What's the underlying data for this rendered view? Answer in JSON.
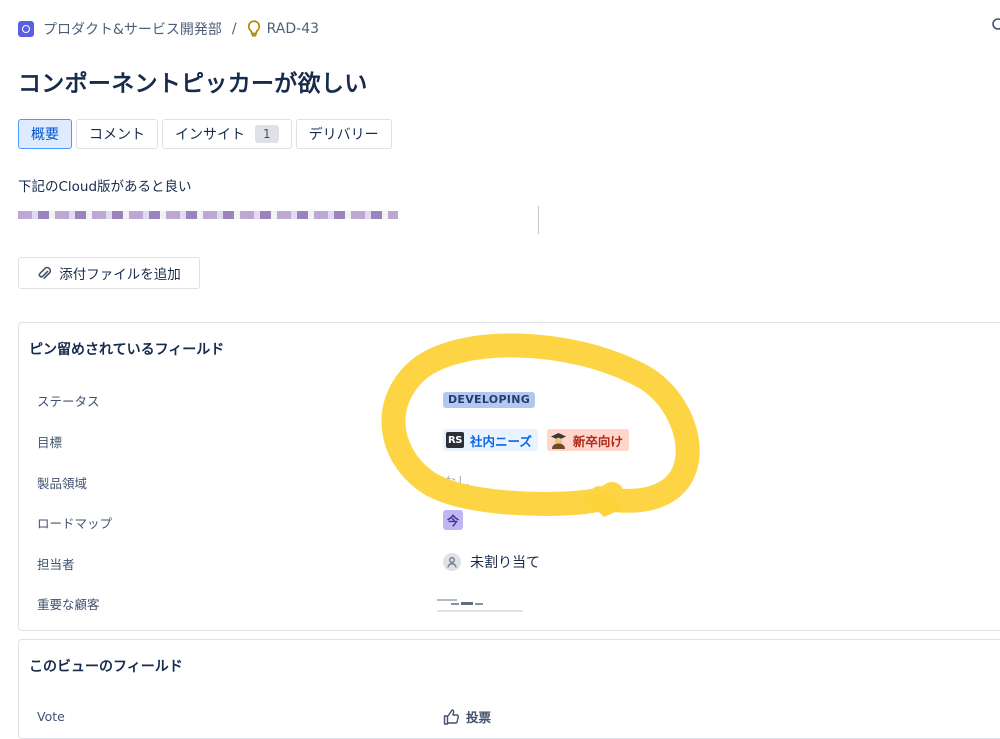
{
  "breadcrumb": {
    "project": "プロダクト&サービス開発部",
    "separator": "/",
    "issue_key": "RAD-43"
  },
  "title": "コンポーネントピッカーが欲しい",
  "tabs": [
    {
      "label": "概要",
      "active": true
    },
    {
      "label": "コメント"
    },
    {
      "label": "インサイト",
      "count": "1"
    },
    {
      "label": "デリバリー"
    }
  ],
  "description": "下記のCloud版があると良い",
  "attach_button": "添付ファイルを追加",
  "pinned": {
    "title": "ピン留めされているフィールド",
    "fields": {
      "status": {
        "label": "ステータス",
        "value": "DEVELOPING"
      },
      "goal": {
        "label": "目標",
        "tags": [
          {
            "badge": "RS",
            "text": "社内ニーズ"
          },
          {
            "text": "新卒向け"
          }
        ]
      },
      "product_area": {
        "label": "製品領域",
        "value": "なし"
      },
      "roadmap": {
        "label": "ロードマップ",
        "value": "今"
      },
      "assignee": {
        "label": "担当者",
        "value": "未割り当て"
      },
      "customers": {
        "label": "重要な顧客"
      }
    }
  },
  "view_fields": {
    "title": "このビューのフィールド",
    "vote": {
      "label": "Vote",
      "value": "投票"
    }
  },
  "colors": {
    "accent": "#0052cc",
    "status_lozenge": "#b3c8ee",
    "annotation": "#fdd33a"
  }
}
